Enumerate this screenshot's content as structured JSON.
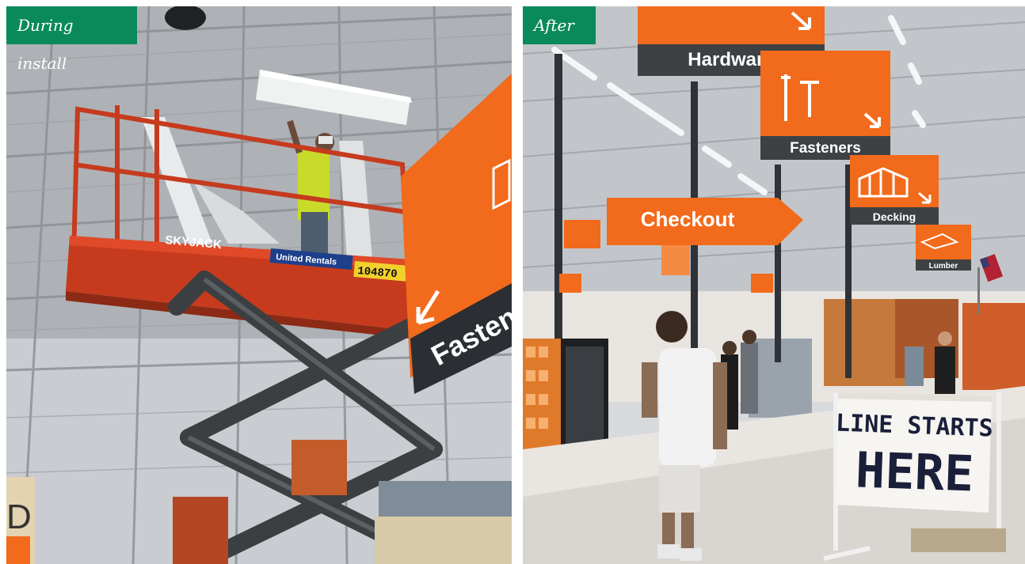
{
  "colors": {
    "tag_green": "#0a8a5a",
    "sign_orange": "#f26a1b",
    "sign_dark": "#2b2f33"
  },
  "before": {
    "label": "During install",
    "lift_brand": "SKYJACK",
    "rental_brand": "United Rentals",
    "lift_number": "104870",
    "partial_sign": "Fasten"
  },
  "after": {
    "label": "After",
    "signs": {
      "hardware": "Hardware",
      "fasteners": "Fasteners",
      "checkout": "Checkout",
      "decking": "Decking",
      "lumber": "Lumber"
    },
    "floor_sign": {
      "line1": "LINE STARTS",
      "line2": "HERE"
    }
  }
}
